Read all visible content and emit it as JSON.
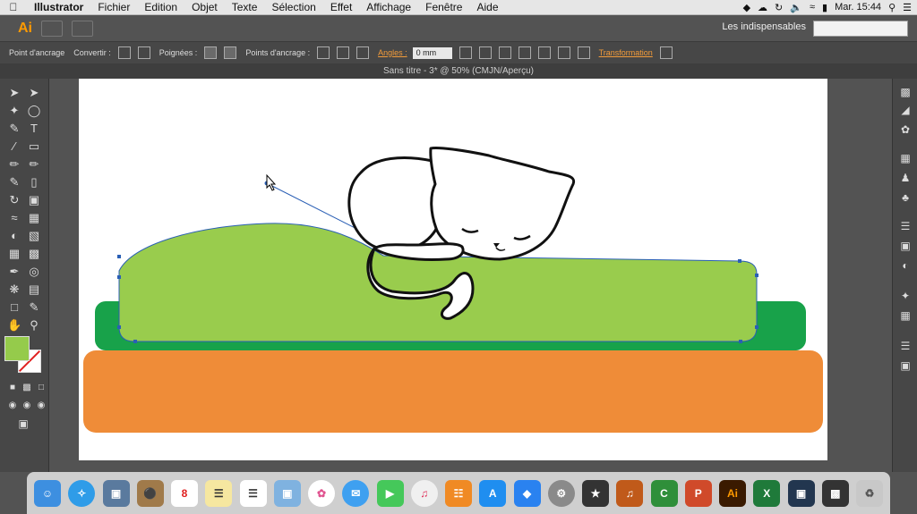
{
  "menubar": {
    "items": [
      "Illustrator",
      "Fichier",
      "Edition",
      "Objet",
      "Texte",
      "Sélection",
      "Effet",
      "Affichage",
      "Fenêtre",
      "Aide"
    ],
    "clock": "Mar. 15:44"
  },
  "appbar": {
    "logo": "Ai",
    "workspace": "Les indispensables"
  },
  "control_bar": {
    "anchor_label": "Point d'ancrage",
    "convert_label": "Convertir :",
    "handles_label": "Poignées :",
    "anchors_label": "Points d'ancrage :",
    "angles_label": "Angles :",
    "angles_value": "0 mm",
    "transform_label": "Transformation"
  },
  "document": {
    "title": "Sans titre - 3* @ 50% (CMJN/Aperçu)"
  },
  "colors": {
    "fill": "#95cb4b",
    "light_green": "#99cc4d",
    "dark_green": "#18a24a",
    "orange": "#ef8c38",
    "selection_blue": "#2a5fb5"
  },
  "tools_left": [
    "selection-tool-icon",
    "direct-selection-tool-icon",
    "magic-wand-icon",
    "lasso-icon",
    "pen-icon",
    "type-icon",
    "line-icon",
    "rectangle-icon",
    "paintbrush-icon",
    "pencil-icon",
    "blob-brush-icon",
    "eraser-icon",
    "rotate-icon",
    "scale-icon",
    "width-icon",
    "free-transform-icon",
    "shape-builder-icon",
    "perspective-icon",
    "mesh-icon",
    "gradient-icon",
    "eyedropper-icon",
    "blend-icon",
    "symbol-sprayer-icon",
    "graph-icon",
    "artboard-icon",
    "slice-icon",
    "hand-icon",
    "zoom-icon"
  ],
  "panels_right": [
    "color-panel-icon",
    "color-guide-icon",
    "appearance-icon",
    "graphic-styles-icon",
    "brushes-icon",
    "symbols-icon",
    "stroke-icon",
    "gradient-panel-icon",
    "transparency-icon",
    "libraries-icon",
    "image-trace-icon",
    "layers-icon",
    "artboards-panel-icon"
  ],
  "dock": {
    "calendar_day": "8"
  }
}
